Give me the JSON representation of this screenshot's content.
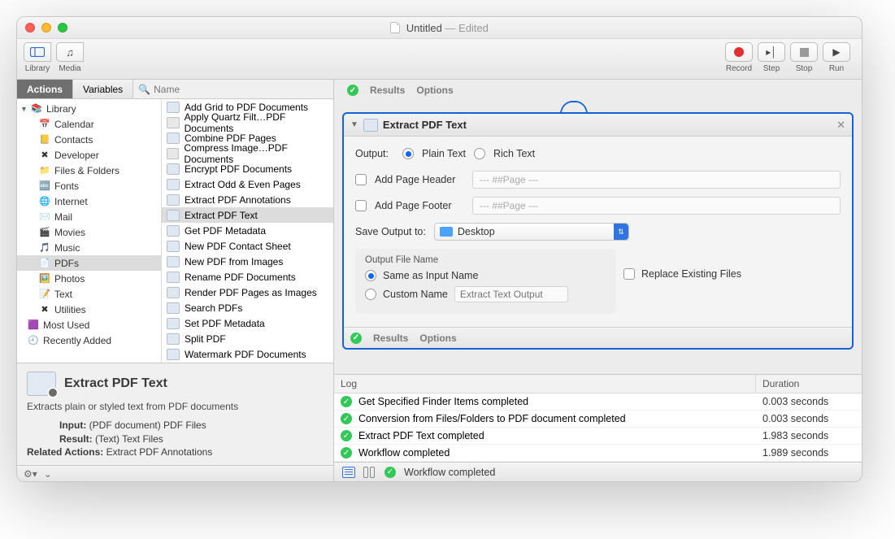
{
  "window": {
    "title": "Untitled",
    "edited_suffix": " — Edited"
  },
  "toolbar": {
    "library": "Library",
    "media": "Media",
    "record": "Record",
    "step": "Step",
    "stop": "Stop",
    "run": "Run"
  },
  "left_tabs": {
    "actions": "Actions",
    "variables": "Variables",
    "search_placeholder": "Name"
  },
  "tree": {
    "root": "Library",
    "items": [
      "Calendar",
      "Contacts",
      "Developer",
      "Files & Folders",
      "Fonts",
      "Internet",
      "Mail",
      "Movies",
      "Music",
      "PDFs",
      "Photos",
      "Text",
      "Utilities"
    ],
    "extra": [
      "Most Used",
      "Recently Added"
    ],
    "selected": "PDFs"
  },
  "actions": {
    "items": [
      "Add Grid to PDF Documents",
      "Apply Quartz Filt…PDF Documents",
      "Combine PDF Pages",
      "Compress Image…PDF Documents",
      "Encrypt PDF Documents",
      "Extract Odd & Even Pages",
      "Extract PDF Annotations",
      "Extract PDF Text",
      "Get PDF Metadata",
      "New PDF Contact Sheet",
      "New PDF from Images",
      "Rename PDF Documents",
      "Render PDF Pages as Images",
      "Search PDFs",
      "Set PDF Metadata",
      "Split PDF",
      "Watermark PDF Documents"
    ],
    "selected": "Extract PDF Text"
  },
  "info": {
    "title": "Extract PDF Text",
    "desc": "Extracts plain or styled text from PDF documents",
    "input_label": "Input:",
    "input_value": "(PDF document) PDF Files",
    "result_label": "Result:",
    "result_value": "(Text) Text Files",
    "related_label": "Related Actions:",
    "related_value": "Extract PDF Annotations"
  },
  "top_strip": {
    "results": "Results",
    "options": "Options"
  },
  "card": {
    "title": "Extract PDF Text",
    "output_label": "Output:",
    "plain": "Plain Text",
    "rich": "Rich Text",
    "add_header": "Add Page Header",
    "header_ph": "--- ##Page ---",
    "add_footer": "Add Page Footer",
    "footer_ph": "--- ##Page ---",
    "save_to_label": "Save Output to:",
    "save_to_value": "Desktop",
    "ofn_head": "Output File Name",
    "same_name": "Same as Input Name",
    "custom_name": "Custom Name",
    "custom_ph": "Extract Text Output",
    "replace": "Replace Existing Files",
    "foot_results": "Results",
    "foot_options": "Options"
  },
  "log": {
    "col_log": "Log",
    "col_duration": "Duration",
    "rows": [
      {
        "msg": "Get Specified Finder Items completed",
        "dur": "0.003 seconds"
      },
      {
        "msg": "Conversion from Files/Folders to PDF document completed",
        "dur": "0.003 seconds"
      },
      {
        "msg": "Extract PDF Text completed",
        "dur": "1.983 seconds"
      },
      {
        "msg": "Workflow completed",
        "dur": "1.989 seconds"
      }
    ]
  },
  "status": {
    "msg": "Workflow completed"
  }
}
